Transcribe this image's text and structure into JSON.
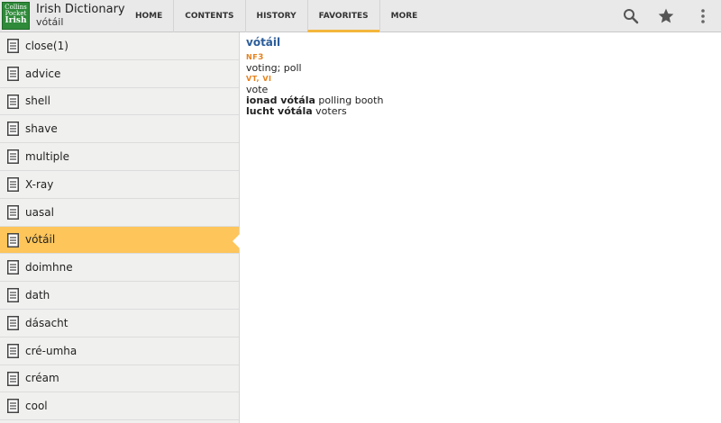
{
  "app": {
    "logo_lines": [
      "Collins",
      "Pocket",
      "Irish"
    ],
    "title": "Irish Dictionary",
    "subtitle": "vótáil"
  },
  "tabs": [
    {
      "label": "HOME",
      "active": false
    },
    {
      "label": "CONTENTS",
      "active": false
    },
    {
      "label": "HISTORY",
      "active": false
    },
    {
      "label": "FAVORITES",
      "active": true
    },
    {
      "label": "MORE",
      "active": false
    }
  ],
  "actions": {
    "search_icon": "search-icon",
    "favorite_icon": "star-icon",
    "overflow_icon": "more-vert-icon"
  },
  "favorites": [
    {
      "label": "close(1)"
    },
    {
      "label": "advice"
    },
    {
      "label": "shell"
    },
    {
      "label": "shave"
    },
    {
      "label": "multiple"
    },
    {
      "label": "X-ray"
    },
    {
      "label": "uasal"
    },
    {
      "label": "vótáil",
      "selected": true
    },
    {
      "label": "doimhne"
    },
    {
      "label": "dath"
    },
    {
      "label": "dásacht"
    },
    {
      "label": "cré-umha"
    },
    {
      "label": "créam"
    },
    {
      "label": "cool"
    }
  ],
  "entry": {
    "headword": "vótáil",
    "pos1": "NF",
    "pos1_num": "3",
    "def1": "voting; poll",
    "pos2": "VT, VI",
    "def2": "vote",
    "ex1_term": "ionad vótála",
    "ex1_def": "polling booth",
    "ex2_term": "lucht vótála",
    "ex2_def": "voters"
  },
  "colors": {
    "accent": "#f3b63c",
    "selected_row": "#fdc55a",
    "headword": "#2b5d9a",
    "pos": "#e5821e",
    "logo": "#2f8a3a"
  }
}
